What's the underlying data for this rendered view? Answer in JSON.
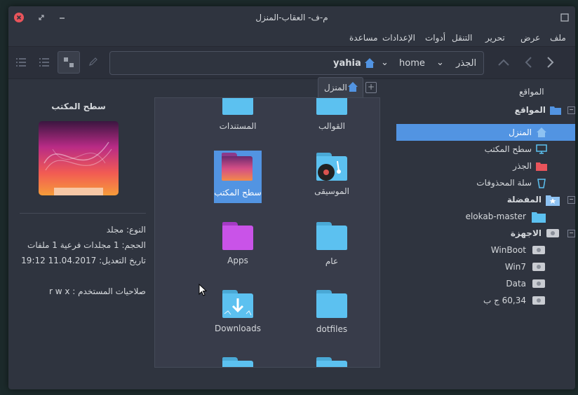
{
  "window": {
    "title": "م-ف- العقاب-المنزل"
  },
  "menu": {
    "items": [
      "ملف",
      "عرض",
      "تحرير",
      "التنقل",
      "أدوات",
      "الإعدادات",
      "مساعدة"
    ]
  },
  "toolbar": {
    "breadcrumbs": [
      "الجذر",
      "home",
      "yahia"
    ]
  },
  "tab": {
    "label": "المنزل"
  },
  "sidebar": {
    "header": "المواقع",
    "places_section": "المواقع",
    "places": [
      "المنزل",
      "سطح المكتب",
      "الجذر",
      "سلة المحذوفات"
    ],
    "favorites_section": "المفضلة",
    "favorites": [
      "elokab-master"
    ],
    "devices_section": "الاجهزة",
    "devices": [
      "WinBoot",
      "Win7",
      "Data",
      "60,34 ج ب"
    ]
  },
  "files": {
    "items": [
      "القوالب",
      "المستندات",
      "الموسيقى",
      "سطح المكتب",
      "عام",
      "Apps",
      "dotfiles",
      "Downloads"
    ]
  },
  "info": {
    "title": "سطح المكتب",
    "type": "النوع: مجلد",
    "size": "الحجم: 1 مجلدات فرعية 1 ملفات",
    "modified": "تاريخ التعديل: 11.04.2017 19:12",
    "permissions": "صلاحيات المستخدم : r w x"
  },
  "colors": {
    "accent": "#5294e2",
    "folder": "#5cc1f0",
    "folder_purple": "#c953e8",
    "window_bg": "#2f343f"
  }
}
